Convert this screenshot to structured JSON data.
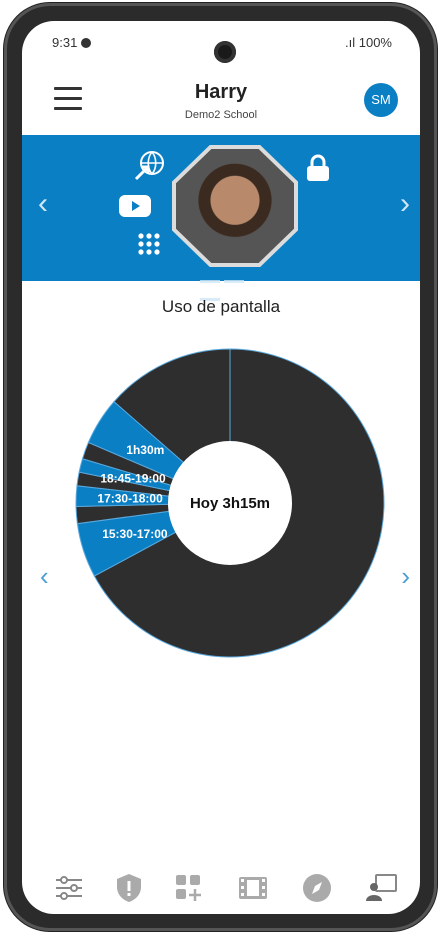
{
  "status": {
    "time": "9:31",
    "battery": ".ıl 100%"
  },
  "header": {
    "title": "Harry",
    "subtitle": "Demo2 School",
    "avatar_initials": "SM"
  },
  "banner": {
    "icons": [
      "globe-arrow-icon",
      "youtube-icon",
      "apps-grid-icon",
      "lock-icon"
    ]
  },
  "section_title": "Uso de pantalla",
  "chart_data": {
    "type": "pie",
    "center_label": "Hoy 3h15m",
    "slices": [
      {
        "label": "",
        "value": 188,
        "color": "#2e2e2e"
      },
      {
        "label": "15:30-17:00",
        "value": 16,
        "color": "#0b7fc4"
      },
      {
        "label": "",
        "value": 5,
        "color": "#2e2e2e"
      },
      {
        "label": "17:30-18:00",
        "value": 6,
        "color": "#0b7fc4"
      },
      {
        "label": "",
        "value": 4,
        "color": "#2e2e2e"
      },
      {
        "label": "18:45-19:00",
        "value": 4,
        "color": "#0b7fc4"
      },
      {
        "label": "",
        "value": 5,
        "color": "#2e2e2e"
      },
      {
        "label": "1h30m",
        "value": 14,
        "color": "#0b7fc4"
      },
      {
        "label": "",
        "value": 38,
        "color": "#2e2e2e"
      }
    ]
  },
  "tabs": [
    "filters-icon",
    "shield-alert-icon",
    "add-app-icon",
    "film-icon",
    "compass-icon",
    "classroom-icon"
  ],
  "colors": {
    "accent": "#0b7fc4",
    "dark": "#2e2e2e"
  }
}
